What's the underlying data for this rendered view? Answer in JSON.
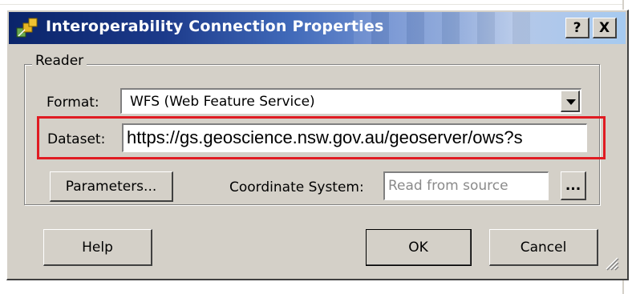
{
  "window": {
    "title": "Interoperability Connection Properties",
    "help_button": "?",
    "close_button": "X"
  },
  "reader": {
    "group_label": "Reader",
    "format_label": "Format:",
    "format_value": "WFS (Web Feature Service)",
    "dataset_label": "Dataset:",
    "dataset_value": "https://gs.geoscience.nsw.gov.au/geoserver/ows?s",
    "parameters_button": "Parameters...",
    "coordinate_system_label": "Coordinate System:",
    "coordinate_system_value": "Read from source",
    "browse_button": "..."
  },
  "footer": {
    "help_button": "Help",
    "ok_button": "OK",
    "cancel_button": "Cancel"
  },
  "colors": {
    "title_gradient_start": "#0a246a",
    "title_gradient_end": "#a6caf0",
    "dialog_face": "#d4d0c8",
    "highlight_border": "#e01b22"
  },
  "icons": {
    "title_icon": "fme-workbench-icon",
    "dropdown": "chevron-down-icon",
    "resize": "resize-grip-icon"
  }
}
